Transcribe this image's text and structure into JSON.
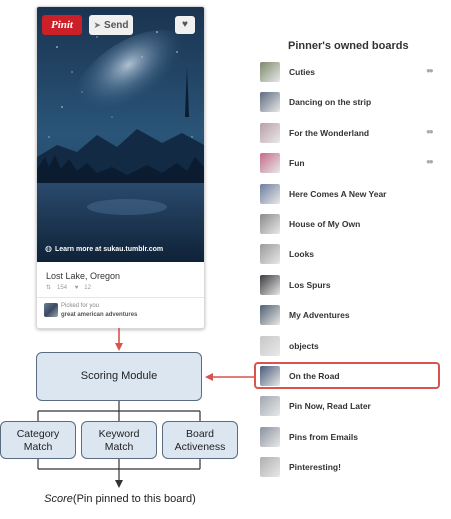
{
  "pin": {
    "pinit_label": "Pinit",
    "send_label": "Send",
    "learn_more": "Learn more at sukau.tumblr.com",
    "description": "Lost Lake, Oregon",
    "repins": "154",
    "likes": "12",
    "picked_label": "Picked for you",
    "picked_board": "great american adventures"
  },
  "boards": {
    "title": "Pinner's owned boards",
    "items": [
      {
        "label": "Cuties",
        "collab": true,
        "thumb": "#7c8a6a"
      },
      {
        "label": "Dancing on the strip",
        "collab": false,
        "thumb": "#5d6b80"
      },
      {
        "label": "For the Wonderland",
        "collab": true,
        "thumb": "#b8a0a8"
      },
      {
        "label": "Fun",
        "collab": true,
        "thumb": "#c46a8a"
      },
      {
        "label": "Here Comes A New Year",
        "collab": false,
        "thumb": "#6e7ea0"
      },
      {
        "label": "House of My Own",
        "collab": false,
        "thumb": "#8a8a8a"
      },
      {
        "label": "Looks",
        "collab": false,
        "thumb": "#9a9a9a"
      },
      {
        "label": "Los Spurs",
        "collab": false,
        "thumb": "#3a3a40"
      },
      {
        "label": "My Adventures",
        "collab": false,
        "thumb": "#4f6070"
      },
      {
        "label": "objects",
        "collab": false,
        "thumb": "#c8c8c8"
      },
      {
        "label": "On the Road",
        "collab": false,
        "thumb": "#4a5a7a"
      },
      {
        "label": "Pin Now, Read Later",
        "collab": false,
        "thumb": "#a0a8b0"
      },
      {
        "label": "Pins from Emails",
        "collab": false,
        "thumb": "#8a92a0"
      },
      {
        "label": "Pinteresting!",
        "collab": false,
        "thumb": "#b0b0b0"
      }
    ]
  },
  "diagram": {
    "scoring_module": "Scoring Module",
    "features": [
      {
        "line1": "Category",
        "line2": "Match"
      },
      {
        "line1": "Keyword",
        "line2": "Match"
      },
      {
        "line1": "Board",
        "line2": "Activeness"
      }
    ],
    "score_word": "Score",
    "score_rest": "(Pin pinned to this board)"
  },
  "colors": {
    "arrow": "#d9534f",
    "box_fill": "#dce6f0",
    "pinit": "#cb2027"
  }
}
